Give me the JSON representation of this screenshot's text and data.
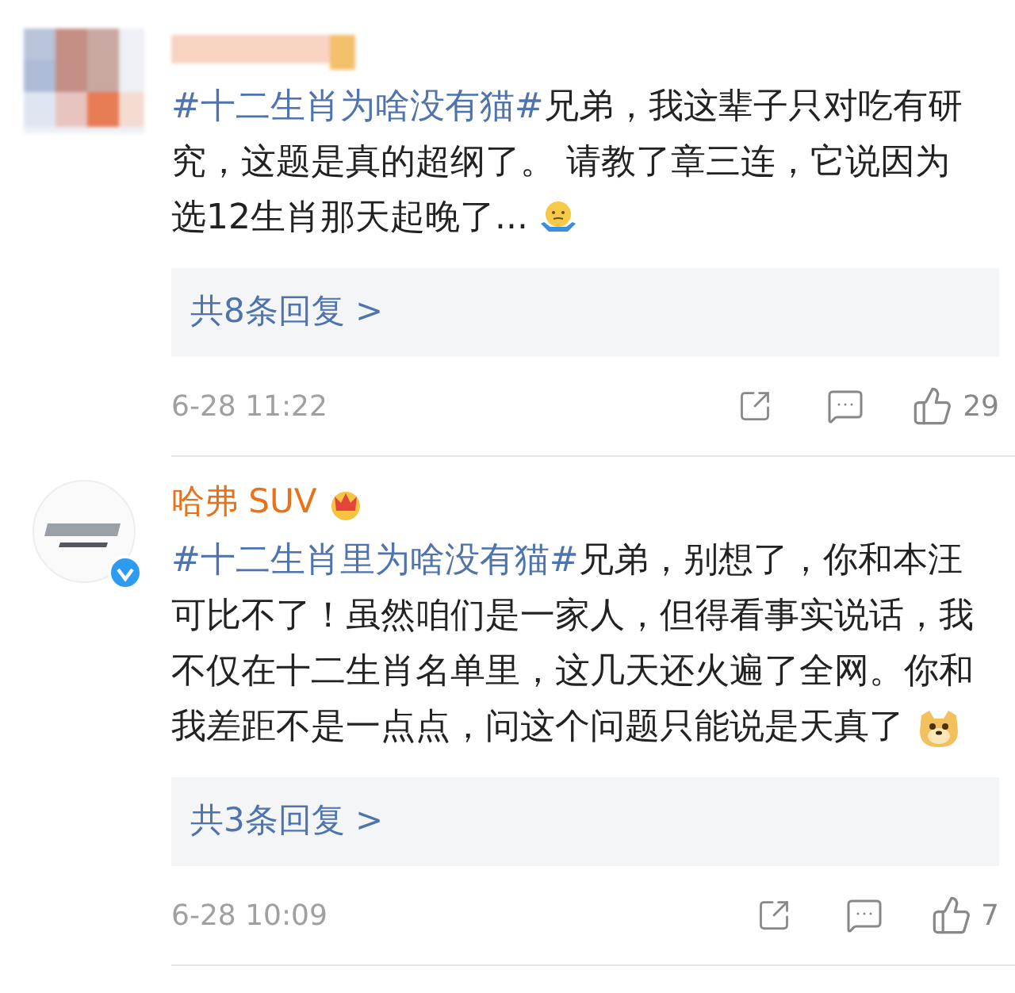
{
  "comments": [
    {
      "kind": "blurred",
      "topic": "#十二生肖为啥没有猫#",
      "text": "兄弟，我这辈子只对吃有研究，这题是真的超纲了。 请教了章三连，它说因为选12生肖那天起晚了...",
      "replies": "共8条回复 >",
      "time": "6-28 11:22",
      "likes": "29"
    },
    {
      "kind": "brand",
      "name": "哈弗 SUV",
      "verified": true,
      "topic": "#十二生肖里为啥没有猫#",
      "text": "兄弟，别想了，你和本汪可比不了！虽然咱们是一家人，但得看事实说话，我不仅在十二生肖名单里，这几天还火遍了全网。你和我差距不是一点点，问这个问题只能说是天真了",
      "replies": "共3条回复 >",
      "time": "6-28 10:09",
      "likes": "7"
    }
  ]
}
